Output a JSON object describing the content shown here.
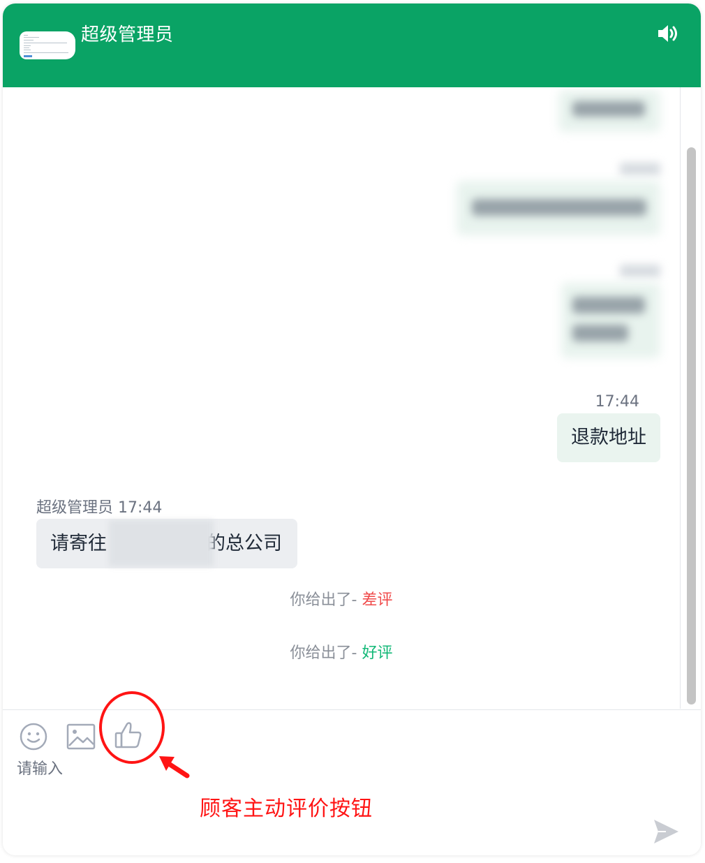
{
  "header": {
    "title": "超级管理员",
    "sound_icon": "speaker-icon",
    "background_color": "#0aa365"
  },
  "messages": {
    "outgoing": {
      "time": "17:44",
      "text": "退款地址"
    },
    "incoming": {
      "sender": "超级管理员",
      "time": "17:44",
      "text_before": "请寄往",
      "text_after": "的总公司"
    },
    "system": [
      {
        "prefix": "你给出了- ",
        "rating": "差评",
        "rating_color": "#f04a4a"
      },
      {
        "prefix": "你给出了- ",
        "rating": "好评",
        "rating_color": "#12b877"
      }
    ]
  },
  "input": {
    "placeholder": "请输入",
    "tools": [
      "emoji-icon",
      "image-icon",
      "thumbs-up-icon"
    ],
    "send_icon": "send-icon"
  },
  "annotation": {
    "text": "顾客主动评价按钮",
    "color": "#ff1414"
  }
}
